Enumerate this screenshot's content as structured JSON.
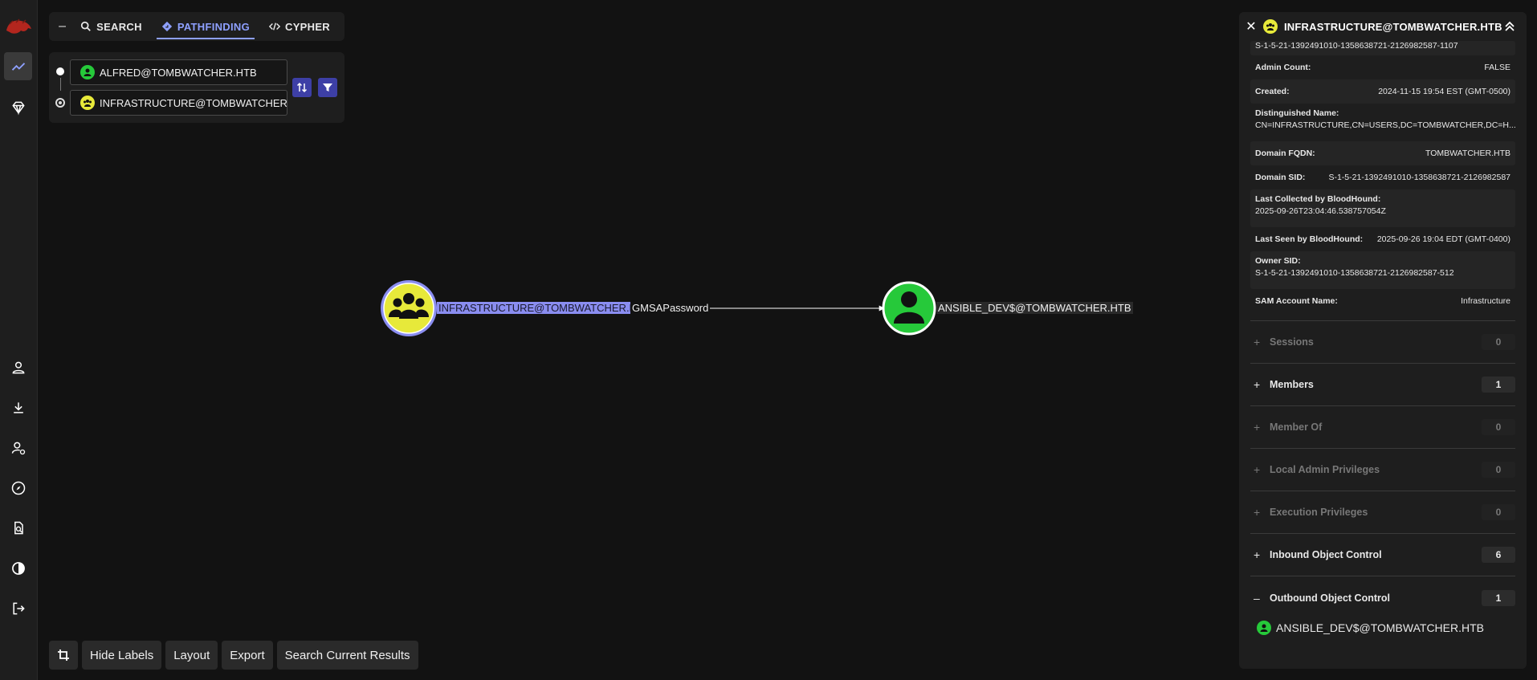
{
  "nav": {
    "items": [
      "logo",
      "explore",
      "group-management",
      "user",
      "download",
      "administration",
      "compass",
      "search-doc",
      "dark-mode",
      "logout"
    ]
  },
  "tabs": {
    "collapse": "–",
    "search": "SEARCH",
    "pathfinding": "PATHFINDING",
    "cypher": "CYPHER"
  },
  "pathfinding": {
    "start": "ALFRED@TOMBWATCHER.HTB",
    "end": "INFRASTRUCTURE@TOMBWATCHER.H"
  },
  "graph": {
    "source_label": "INFRASTRUCTURE@TOMBWATCHER.HTB",
    "edge_label": "GMSAPassword",
    "target_label": "ANSIBLE_DEV$@TOMBWATCHER.HTB",
    "colors": {
      "group": "#e7e93a",
      "user": "#26c93a",
      "selected": "#8a8df0"
    }
  },
  "toolbar": {
    "hide_labels": "Hide Labels",
    "layout": "Layout",
    "export": "Export",
    "search_results": "Search Current Results"
  },
  "panel": {
    "title": "INFRASTRUCTURE@TOMBWATCHER.HTB",
    "top_value": "S-1-5-21-1392491010-1358638721-2126982587-1107",
    "props": [
      {
        "k": "Admin Count:",
        "v": "FALSE"
      },
      {
        "k": "Created:",
        "v": "2024-11-15 19:54 EST (GMT-0500)"
      },
      {
        "k": "Distinguished Name:",
        "v": "CN=INFRASTRUCTURE,CN=USERS,DC=TOMBWATCHER,DC=H..."
      },
      {
        "k": "Domain FQDN:",
        "v": "TOMBWATCHER.HTB"
      },
      {
        "k": "Domain SID:",
        "v": "S-1-5-21-1392491010-1358638721-2126982587"
      },
      {
        "k": "Last Collected by BloodHound:",
        "v": "2025-09-26T23:04:46.538757054Z"
      },
      {
        "k": "Last Seen by BloodHound:",
        "v": "2025-09-26 19:04 EDT (GMT-0400)"
      },
      {
        "k": "Owner SID:",
        "v": "S-1-5-21-1392491010-1358638721-2126982587-512"
      },
      {
        "k": "SAM Account Name:",
        "v": "Infrastructure"
      }
    ],
    "sections": [
      {
        "label": "Sessions",
        "count": "0",
        "sign": "+"
      },
      {
        "label": "Members",
        "count": "1",
        "sign": "+"
      },
      {
        "label": "Member Of",
        "count": "0",
        "sign": "+"
      },
      {
        "label": "Local Admin Privileges",
        "count": "0",
        "sign": "+"
      },
      {
        "label": "Execution Privileges",
        "count": "0",
        "sign": "+"
      },
      {
        "label": "Inbound Object Control",
        "count": "6",
        "sign": "+"
      },
      {
        "label": "Outbound Object Control",
        "count": "1",
        "sign": "–"
      }
    ],
    "outbound_item": "ANSIBLE_DEV$@TOMBWATCHER.HTB"
  }
}
